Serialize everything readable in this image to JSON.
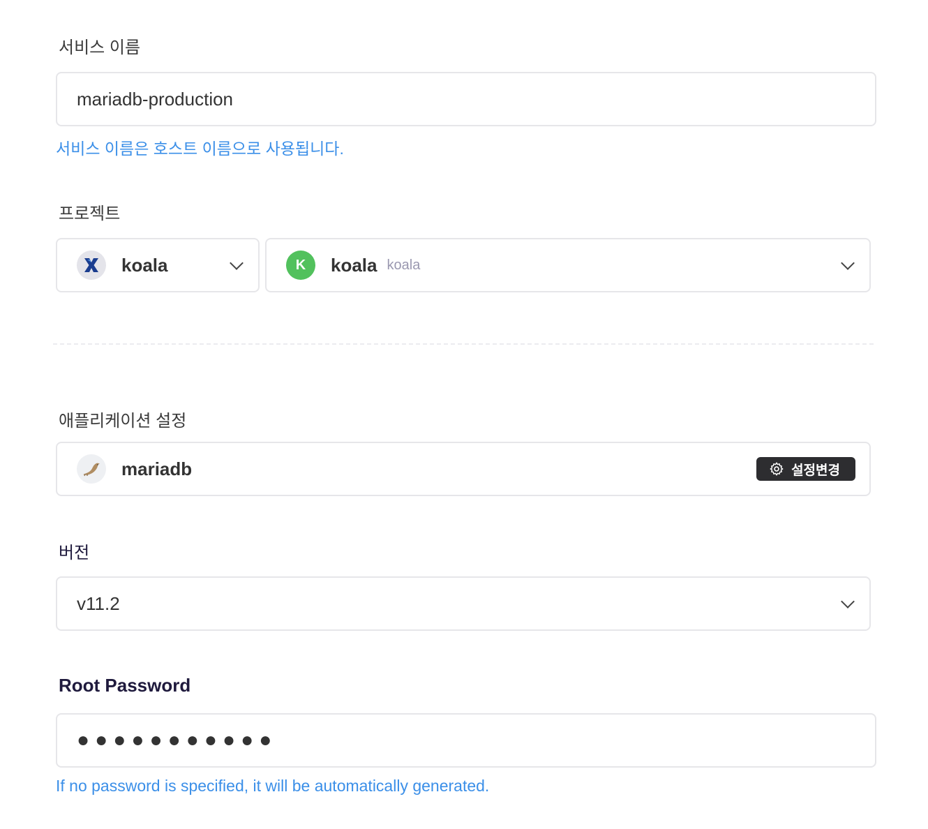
{
  "service_name": {
    "label": "서비스 이름",
    "value": "mariadb-production",
    "hint": "서비스 이름은 호스트 이름으로 사용됩니다."
  },
  "project": {
    "label": "프로젝트",
    "workspace": {
      "name": "koala",
      "icon": "workspace-x-logo-icon"
    },
    "project": {
      "avatar_letter": "K",
      "name": "koala",
      "sub_name": "koala",
      "avatar_color": "#52c15d"
    }
  },
  "application": {
    "label": "애플리케이션 설정",
    "name": "mariadb",
    "icon": "mariadb-seal-icon",
    "change_button": "설정변경"
  },
  "version": {
    "label": "버전",
    "value": "v11.2"
  },
  "root_password": {
    "label": "Root Password",
    "masked_value": "●●●●●●●●●●●",
    "hint": "If no password is specified, it will be automatically generated."
  },
  "colors": {
    "hint": "#3b8fe8",
    "button_dark": "#2d2d30",
    "border": "#e6e6e9"
  }
}
